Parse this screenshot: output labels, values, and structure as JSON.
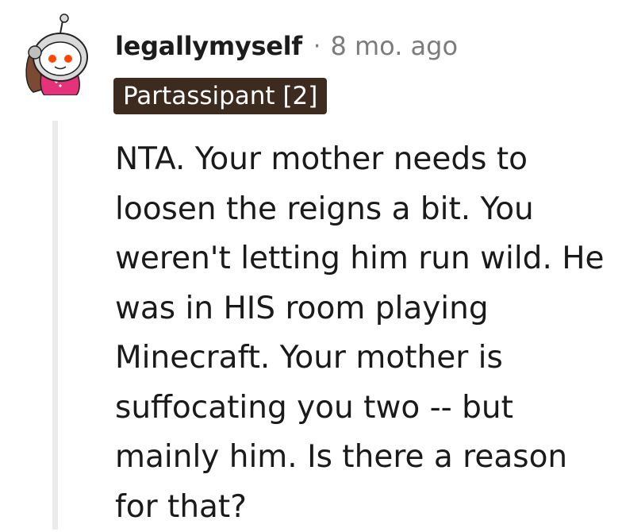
{
  "comment": {
    "username": "legallymyself",
    "separator": "·",
    "timestamp": "8 mo. ago",
    "flair": "Partassipant [2]",
    "body": "NTA. Your mother needs to loosen the reigns a bit. You weren't letting him run wild. He was in HIS room playing Minecraft. Your mother is suffocating you two -- but mainly him. Is there a reason for that?",
    "avatar_icon": "snoo-astronaut-avatar-icon",
    "thread_line_icon": "thread-collapse-line"
  },
  "colors": {
    "flair_bg": "#3d2b20",
    "flair_text": "#ffffff",
    "username": "#1c1c1c",
    "meta_gray": "#7c7c7c",
    "thread_line": "#ebebeb",
    "avatar_helmet": "#d9d9d9",
    "avatar_hair": "#7a4a33",
    "avatar_shirt": "#e5337b"
  }
}
